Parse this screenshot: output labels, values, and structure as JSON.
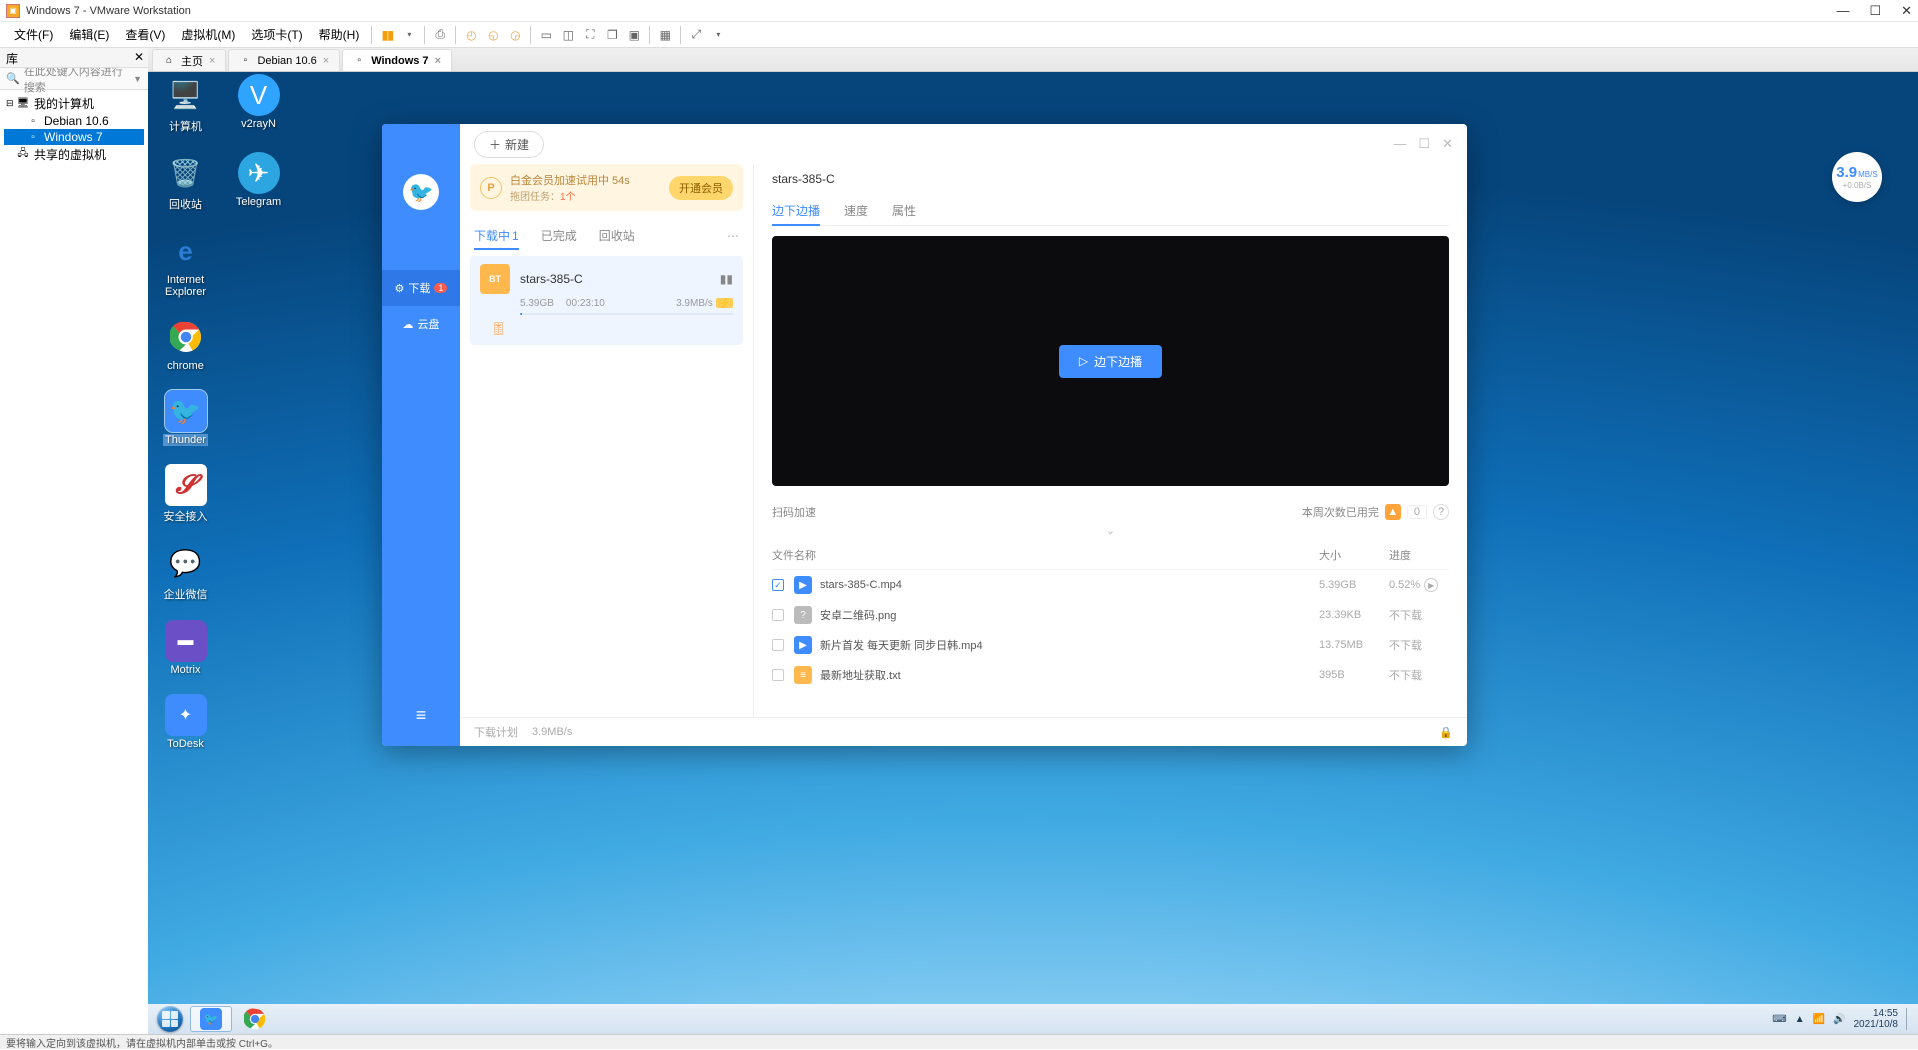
{
  "titlebar": {
    "title": "Windows 7 - VMware Workstation"
  },
  "menubar": {
    "items": [
      "文件(F)",
      "编辑(E)",
      "查看(V)",
      "虚拟机(M)",
      "选项卡(T)",
      "帮助(H)"
    ]
  },
  "library": {
    "header": "库",
    "search_placeholder": "在此处键入内容进行搜索",
    "tree": {
      "root": "我的计算机",
      "debian": "Debian 10.6",
      "win7": "Windows 7",
      "shared": "共享的虚拟机"
    }
  },
  "tabs": {
    "home": "主页",
    "debian": "Debian 10.6",
    "win7": "Windows 7"
  },
  "desktop_icons": {
    "computer": "计算机",
    "v2rayn": "v2rayN",
    "recycle": "回收站",
    "telegram": "Telegram",
    "ie": "Internet\nExplorer",
    "chrome": "chrome",
    "thunder": "Thunder",
    "anquan": "安全接入",
    "qywx": "企业微信",
    "motrix": "Motrix",
    "todesk": "ToDesk"
  },
  "thunder": {
    "new_btn": "新建",
    "side": {
      "download": "下载",
      "download_badge": "1",
      "cloud": "云盘"
    },
    "promo": {
      "title": "白金会员加速试用中 54s",
      "sub_pre": "拖团任务：",
      "sub_n": "1个",
      "btn": "开通会员"
    },
    "dl_tabs": {
      "active": "下载中",
      "active_count": "1",
      "done": "已完成",
      "trash": "回收站"
    },
    "task": {
      "name": "stars-385-C",
      "size": "5.39GB",
      "eta": "00:23:10",
      "speed": "3.9MB/s"
    },
    "right": {
      "title": "stars-385-C",
      "tabs": {
        "play": "边下边播",
        "speed": "速度",
        "attr": "属性"
      },
      "play_btn": "边下边播",
      "scan_label": "扫码加速",
      "week_label": "本周次数已用完",
      "week_count": "0",
      "file_hdr": {
        "name": "文件名称",
        "size": "大小",
        "progress": "进度"
      },
      "files": [
        {
          "checked": true,
          "type": "video",
          "name": "stars-385-C.mp4",
          "size": "5.39GB",
          "progress": "0.52%",
          "play": true
        },
        {
          "checked": false,
          "type": "img",
          "name": "安卓二维码.png",
          "size": "23.39KB",
          "progress": "不下载",
          "play": false
        },
        {
          "checked": false,
          "type": "video",
          "name": "新片首发 每天更新 同步日韩.mp4",
          "size": "13.75MB",
          "progress": "不下载",
          "play": false
        },
        {
          "checked": false,
          "type": "txt",
          "name": "最新地址获取.txt",
          "size": "395B",
          "progress": "不下载",
          "play": false
        }
      ]
    },
    "footer": {
      "plan": "下载计划",
      "speed": "3.9MB/s"
    }
  },
  "netbadge": {
    "value": "3.9",
    "unit": "MB/S",
    "sub": "+0.0B/S"
  },
  "taskbar": {
    "time": "14:55",
    "date": "2021/10/8"
  },
  "hoststatus": "要将输入定向到该虚拟机，请在虚拟机内部单击或按 Ctrl+G。"
}
